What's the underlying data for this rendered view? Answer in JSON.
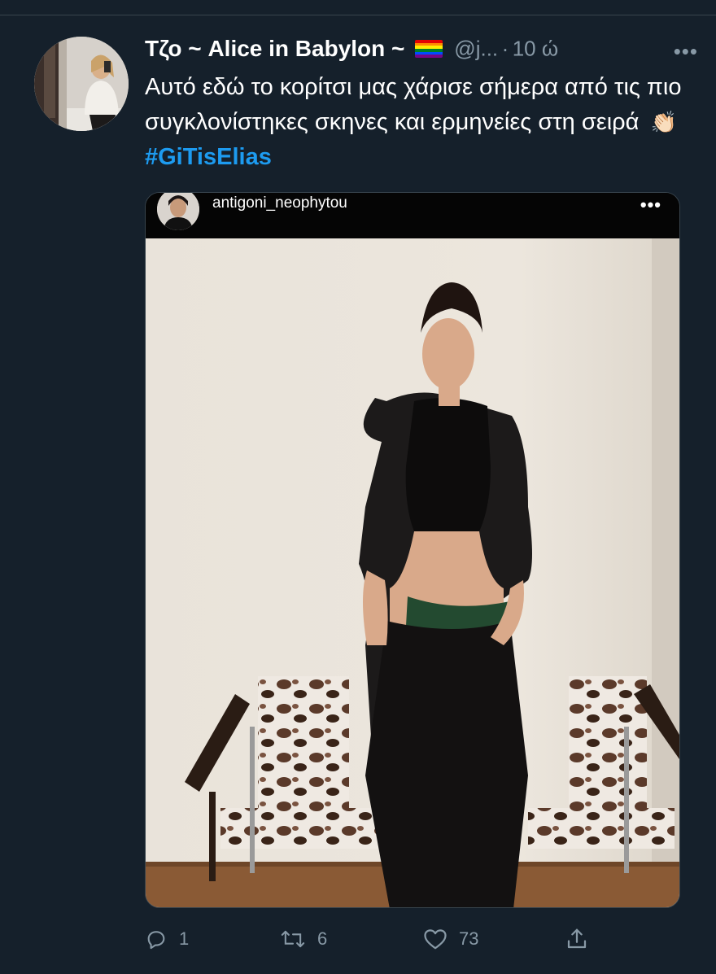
{
  "tweet": {
    "display_name": "Τζο ~ Alice in Babylon ~",
    "flag_icon": "rainbow-flag-icon",
    "handle": "@j...",
    "separator": "·",
    "time": "10 ώ",
    "more_icon": "more-icon",
    "text_part1": "Αυτό εδώ το κορίτσι μας χάρισε σήμερα από τις πιο συγκλονίστηκες σκηνες και ερμηνείες στη σειρά",
    "clap_emoji": "👏🏻",
    "hashtag": "#GiTisElias"
  },
  "media": {
    "instagram_username": "antigoni_neophytou",
    "more_label": "•••"
  },
  "actions": {
    "reply_count": "1",
    "retweet_count": "6",
    "like_count": "73"
  },
  "colors": {
    "background": "#15202b",
    "secondary_text": "#8899a6",
    "link": "#1d9bf0",
    "divider": "#38444d"
  }
}
